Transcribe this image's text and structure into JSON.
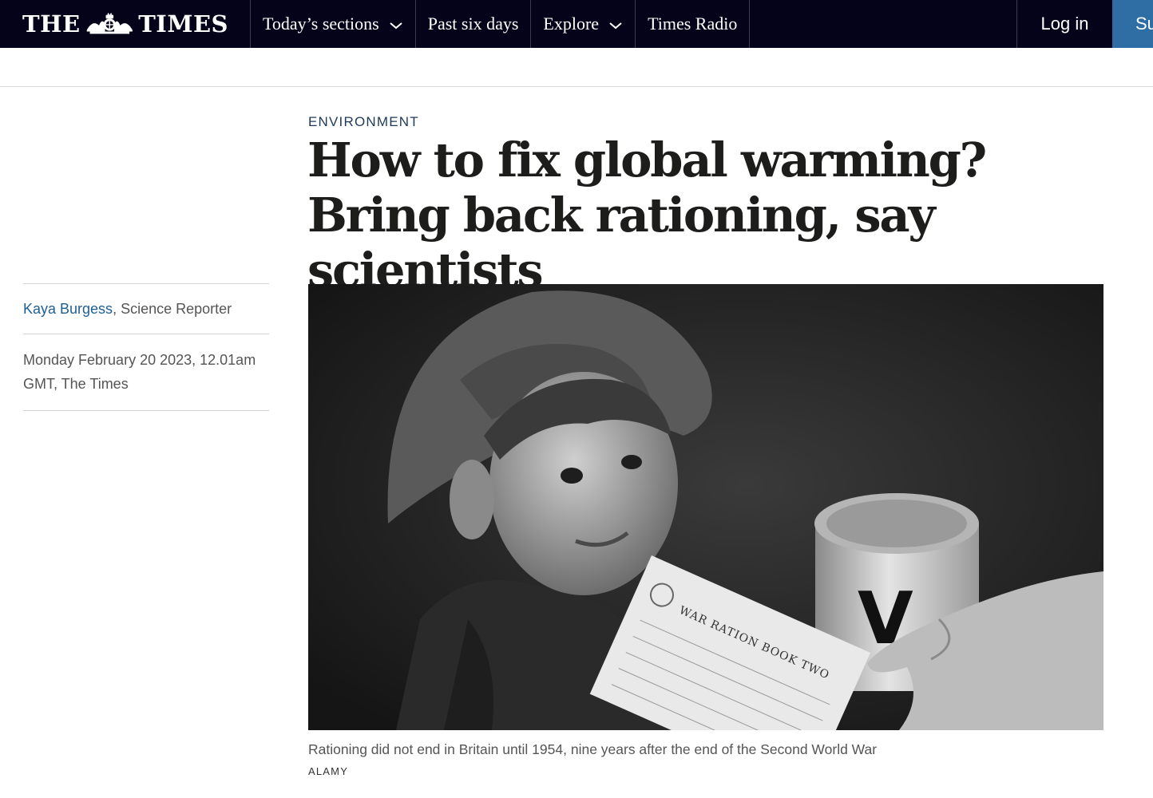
{
  "header": {
    "logo_left": "THE",
    "logo_right": "TIMES",
    "nav": [
      {
        "label": "Today’s sections",
        "has_dropdown": true
      },
      {
        "label": "Past six days",
        "has_dropdown": false
      },
      {
        "label": "Explore",
        "has_dropdown": true
      },
      {
        "label": "Times Radio",
        "has_dropdown": false
      }
    ],
    "login_label": "Log in",
    "subscribe_label": "Subscribe"
  },
  "article": {
    "section": "ENVIRONMENT",
    "headline": "How to fix global warming? Bring back rationing, say scientists",
    "author": "Kaya Burgess",
    "author_role": ", Science Reporter",
    "date": "Monday February 20 2023, 12.01am GMT, The Times",
    "image": {
      "ration_book_text": "WAR RATION BOOK TWO",
      "can_letter": "V",
      "caption": "Rationing did not end in Britain until 1954, nine years after the end of the Second World War",
      "credit": "ALAMY"
    }
  },
  "colors": {
    "nav_bg": "#04031a",
    "subscribe_bg": "#2f6ea4",
    "author_link": "#1f5f94",
    "section_label": "#1f3a57"
  },
  "icons": [
    "crest-icon",
    "chevron-down-icon"
  ]
}
